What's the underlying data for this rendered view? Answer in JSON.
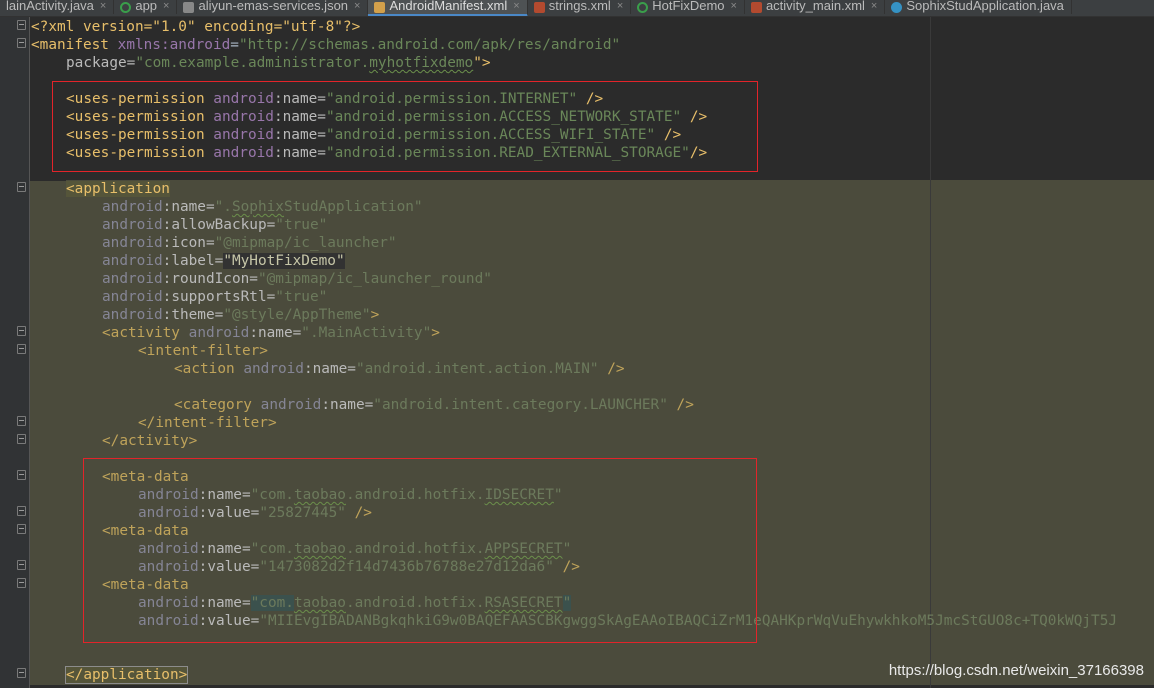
{
  "tabs": [
    {
      "label": "lainActivity.java",
      "icon": "java-class-icon",
      "active": false
    },
    {
      "label": "app",
      "icon": "gradle-module-icon",
      "active": false
    },
    {
      "label": "aliyun-emas-services.json",
      "icon": "json-file-icon",
      "active": false
    },
    {
      "label": "AndroidManifest.xml",
      "icon": "manifest-file-icon",
      "active": true
    },
    {
      "label": "strings.xml",
      "icon": "xml-resource-icon",
      "active": false
    },
    {
      "label": "HotFixDemo",
      "icon": "gradle-module-icon",
      "active": false
    },
    {
      "label": "activity_main.xml",
      "icon": "layout-file-icon",
      "active": false
    },
    {
      "label": "SophixStudApplication.java",
      "icon": "java-class-icon",
      "active": false
    }
  ],
  "close_glyph": "×",
  "code": {
    "xml_decl": "<?xml version=\"1.0\" encoding=\"utf-8\"?>",
    "manifest_open": "<manifest",
    "manifest_xmlns_ns": "xmlns:android",
    "manifest_xmlns_val": "\"http://schemas.android.com/apk/res/android\"",
    "package_attr": "package=",
    "package_val_a": "\"com.example.administrator.",
    "package_val_b": "myhotfixdemo",
    "package_val_c": "\">",
    "permissions": [
      "\"android.permission.INTERNET\"",
      "\"android.permission.ACCESS_NETWORK_STATE\"",
      "\"android.permission.ACCESS_WIFI_STATE\"",
      "\"android.permission.READ_EXTERNAL_STORAGE\""
    ],
    "uses_permission_tag": "<uses-permission",
    "android_ns": "android",
    "name_attr": ":name=",
    "value_attr": ":value=",
    "application_open": "<application",
    "app_attrs": [
      {
        "attr": ":name=",
        "val_a": "\".",
        "val_b": "Sophix",
        "val_c": "StudApplication\""
      },
      {
        "attr": ":allowBackup=",
        "val_a": "\"true\"",
        "val_b": "",
        "val_c": ""
      },
      {
        "attr": ":icon=",
        "val_a": "\"@mipmap/ic_launcher\"",
        "val_b": "",
        "val_c": ""
      },
      {
        "attr": ":label=",
        "val_a": "\"MyHotFixDemo\"",
        "val_b": "",
        "val_c": ""
      },
      {
        "attr": ":roundIcon=",
        "val_a": "\"@mipmap/ic_launcher_round\"",
        "val_b": "",
        "val_c": ""
      },
      {
        "attr": ":supportsRtl=",
        "val_a": "\"true\"",
        "val_b": "",
        "val_c": ""
      },
      {
        "attr": ":theme=",
        "val_a": "\"@style/AppTheme\"",
        "val_b": "",
        "val_c": ""
      }
    ],
    "app_attr_close": ">",
    "activity_open": "<activity",
    "activity_name_val": "\".MainActivity\"",
    "intent_filter_open": "<intent-filter>",
    "action_tag": "<action",
    "action_val": "\"android.intent.action.MAIN\"",
    "category_tag": "<category",
    "category_val": "\"android.intent.category.LAUNCHER\"",
    "self_close": "/>",
    "self_close_gt": ">",
    "intent_filter_close": "</intent-filter>",
    "activity_close": "</activity>",
    "meta_data_tag": "<meta-data",
    "meta": [
      {
        "name_a": "\"com.",
        "name_b": "taobao",
        "name_c": ".android.hotfix.",
        "name_d": "IDSECRET",
        "name_e": "\"",
        "value": "\"25827445\""
      },
      {
        "name_a": "\"com.",
        "name_b": "taobao",
        "name_c": ".android.hotfix.",
        "name_d": "APPSECRET",
        "name_e": "\"",
        "value": "\"1473082d2f14d7436b76788e27d12da6\""
      },
      {
        "name_a": "\"com.",
        "name_b": "taobao",
        "name_c": ".android.hotfix.",
        "name_d": "RSASECRET",
        "name_e": "\"",
        "value": "\"MIIEvgIBADANBgkqhkiG9w0BAQEFAASCBKgwggSkAgEAAoIBAQCiZrM1eQAHKprWqVuEhywkhkoM5JmcStGUO8c+TQ0kWQjT5J"
      }
    ],
    "application_close": "</application>"
  },
  "watermark": "https://blog.csdn.net/weixin_37166398",
  "colors": {
    "editor_bg": "#2b2b2b",
    "highlight_bg": "#4b4b3c",
    "tag": "#e8bf6a",
    "namespace": "#9876aa",
    "string": "#6a8759",
    "annotation_box": "#e2242a"
  }
}
